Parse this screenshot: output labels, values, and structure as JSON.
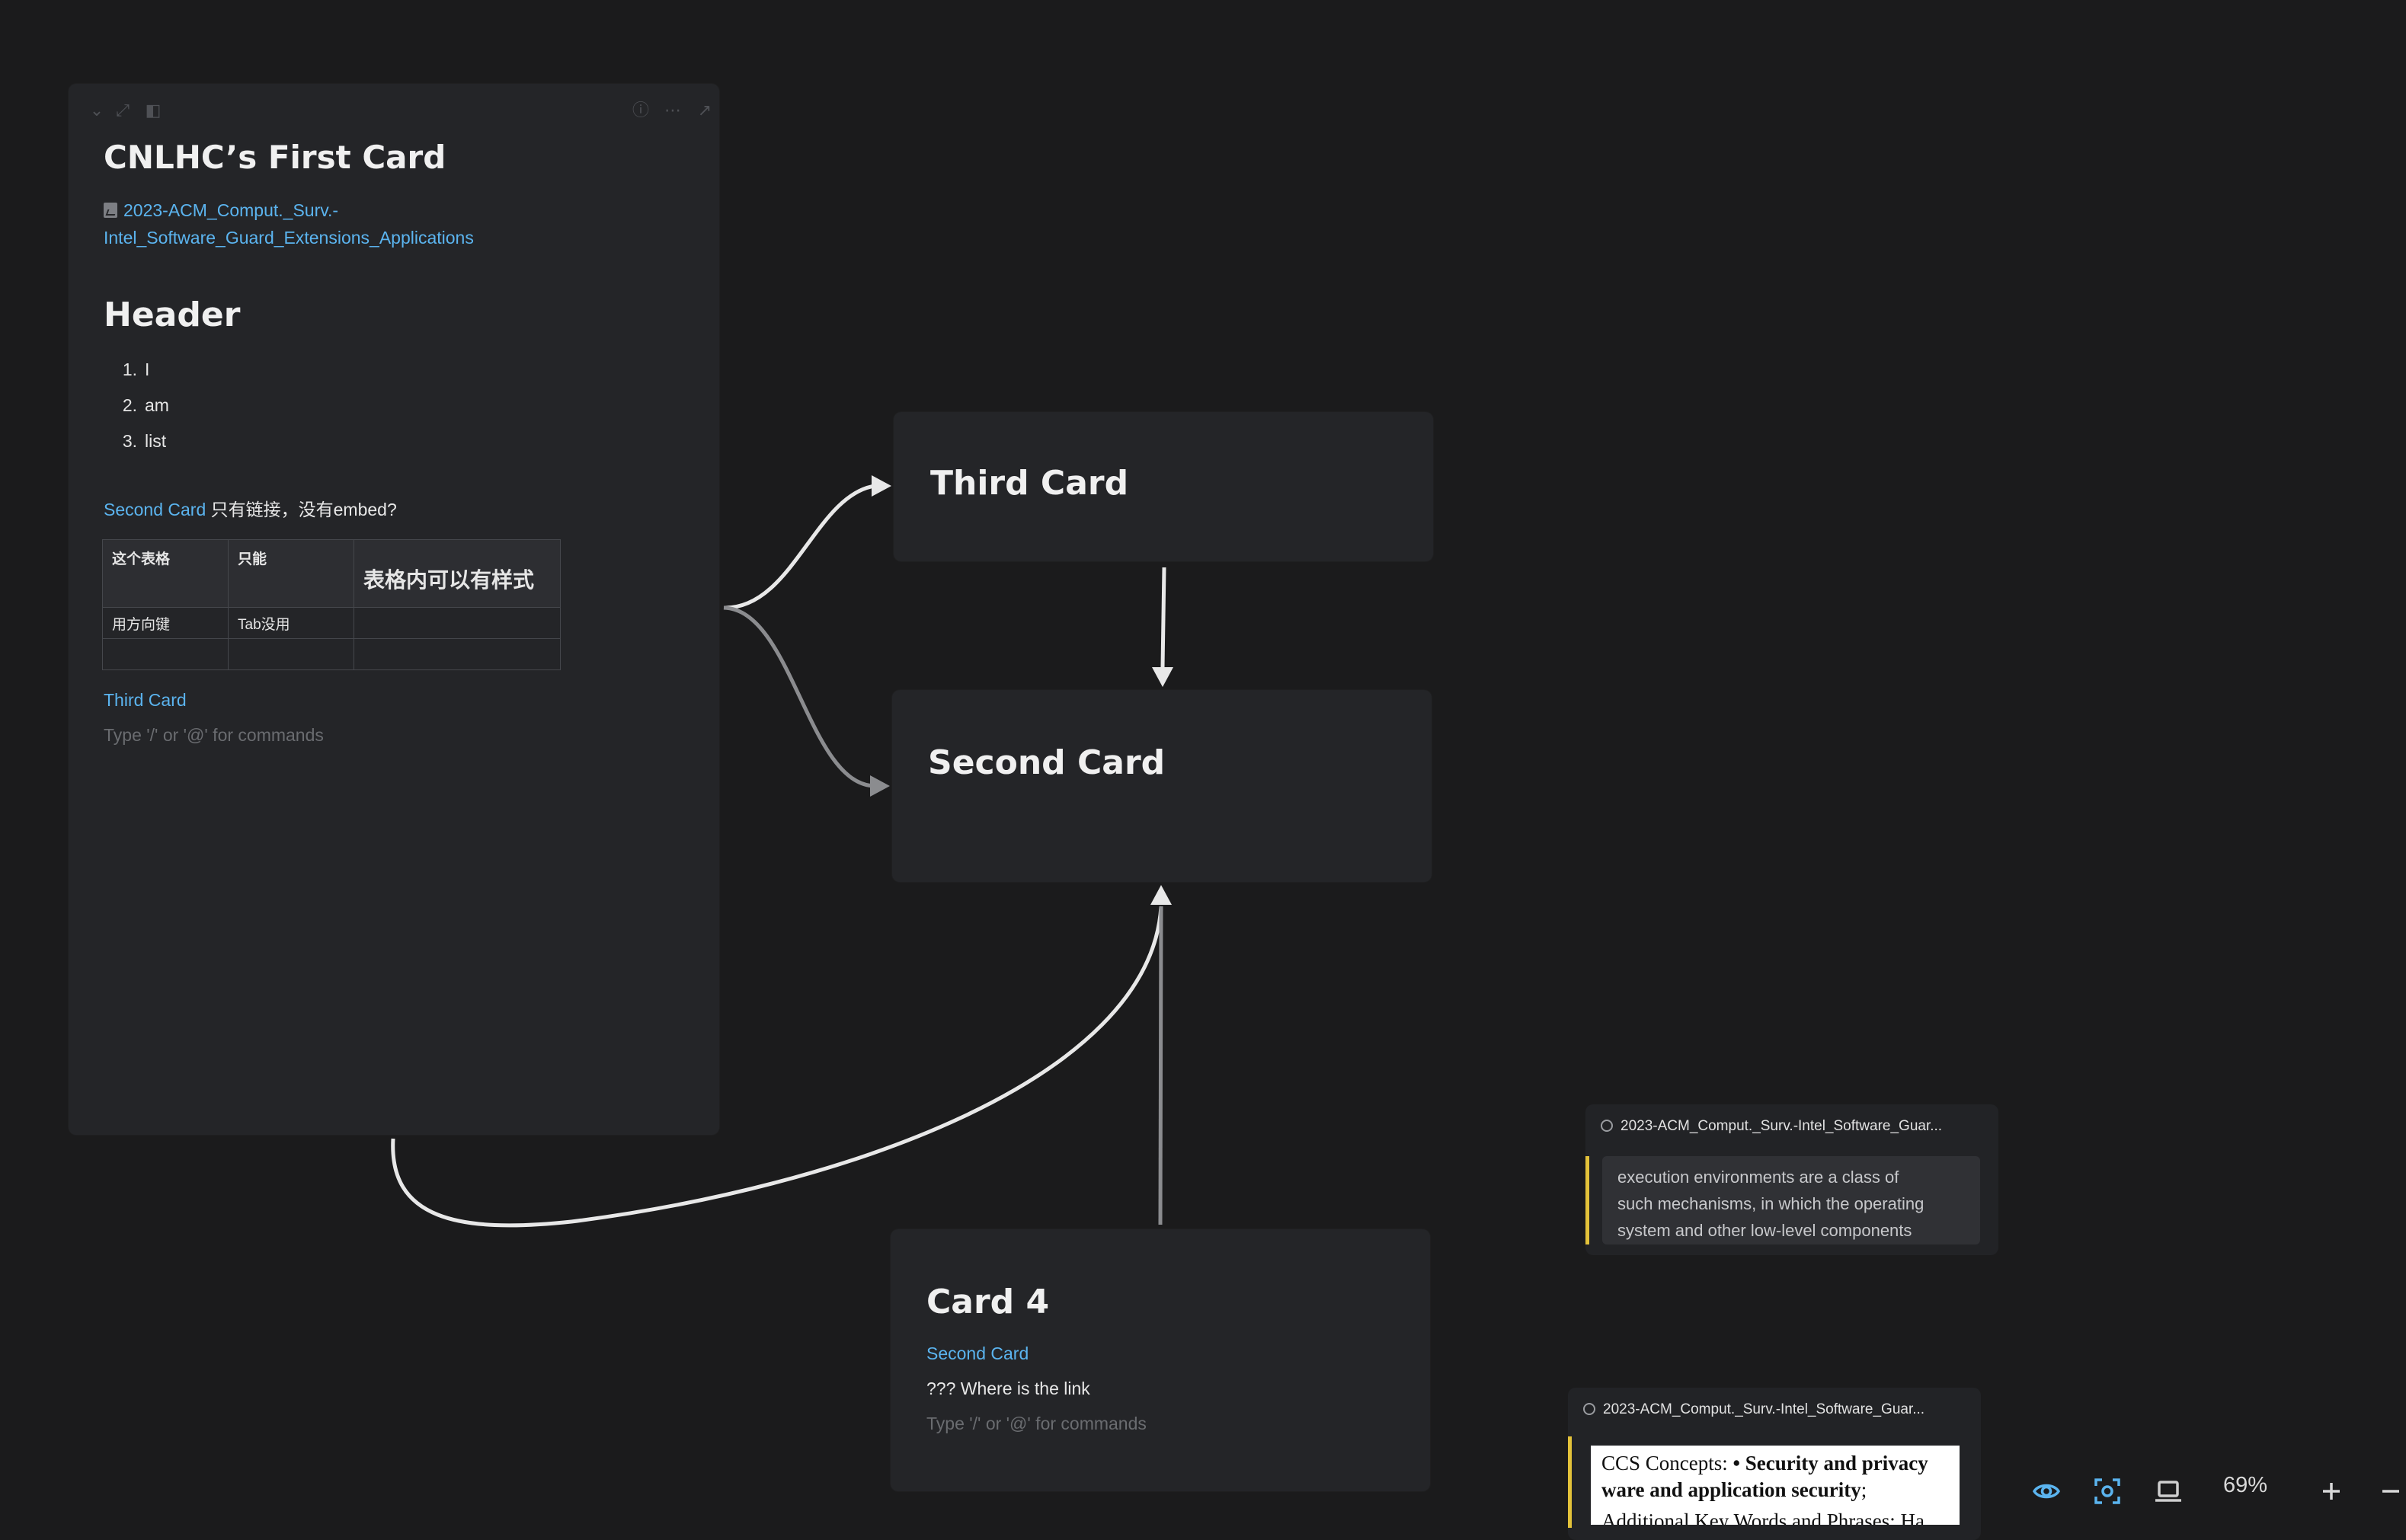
{
  "first_card": {
    "title": "CNLHC’s First Card",
    "pdf_link": "2023-ACM_Comput._Surv.-Intel_Software_Guard_Extensions_Applications",
    "pdf_link_line1": "2023-ACM_Comput._Surv.-",
    "pdf_link_line2": "Intel_Software_Guard_Extensions_Applications",
    "heading": "Header",
    "list": [
      {
        "num": "1.",
        "text": "I"
      },
      {
        "num": "2.",
        "text": "am"
      },
      {
        "num": "3.",
        "text": "list"
      }
    ],
    "link_line": {
      "link": "Second Card",
      "text": " 只有链接，没有embed?"
    },
    "table": {
      "headers": [
        "这个表格",
        "只能",
        "表格内可以有样式"
      ],
      "rows": [
        [
          "用方向键",
          "Tab没用",
          ""
        ],
        [
          "",
          "",
          ""
        ]
      ]
    },
    "third_link": "Third Card",
    "placeholder": "Type '/' or '@' for commands"
  },
  "third_card": {
    "title": "Third Card"
  },
  "second_card": {
    "title": "Second Card"
  },
  "card4": {
    "title": "Card 4",
    "link": "Second Card",
    "text": "??? Where is the link",
    "placeholder": "Type '/' or '@' for commands"
  },
  "snippet1": {
    "source": "2023-ACM_Comput._Surv.-Intel_Software_Guar...",
    "quote_lines": [
      "execution environments are a class of",
      "such mechanisms, in which the operating",
      "system and other low-level components"
    ]
  },
  "snippet2": {
    "source": "2023-ACM_Comput._Surv.-Intel_Software_Guar...",
    "line1_plain": "CCS Concepts: ",
    "line1_bold": "• Security and privacy",
    "line2_bold": "ware and application security",
    "line2_plain": ";",
    "line3": "Additional Key Words and Phrases: Ha"
  },
  "toolbar": {
    "zoom": "69%",
    "icons": [
      "eye-icon",
      "focus-icon",
      "laptop-icon",
      "plus-icon",
      "minus-icon"
    ]
  },
  "colors": {
    "accent": "#5bb4ef",
    "highlight": "#e3c23a",
    "background": "#1b1b1c",
    "card": "#242528"
  }
}
